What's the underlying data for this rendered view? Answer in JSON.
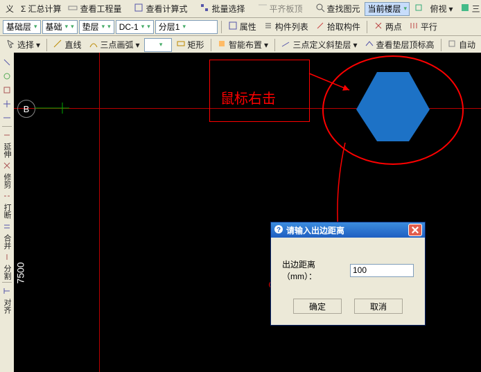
{
  "toolbar1": {
    "yi": "义",
    "sum": "汇总计算",
    "viewqty": "查看工程量",
    "viewcalc": "查看计算式",
    "batch": "批量选择",
    "align": "平齐板顶",
    "find": "查找图元",
    "floor": "当前楼层",
    "view": "俯视",
    "san": "三"
  },
  "toolbar2": {
    "layer1": "基础层",
    "layer2": "基础",
    "layer3": "垫层",
    "dc": "DC-1",
    "split": "分层1",
    "prop": "属性",
    "list": "构件列表",
    "pick": "拾取构件",
    "twop": "两点",
    "para": "平行"
  },
  "toolbar3": {
    "select": "选择",
    "line": "直线",
    "arc": "三点画弧",
    "rect": "矩形",
    "smart": "智能布置",
    "def3": "三点定义斜垫层",
    "viewtop": "查看垫层顶标高",
    "auto": "自动"
  },
  "side": {
    "yan": "延伸",
    "xiu": "修剪",
    "da": "打断",
    "he": "合并",
    "fen": "分割",
    "dui": "对齐"
  },
  "canvas": {
    "marker": "B",
    "dim": "7500"
  },
  "anno": {
    "rightclick": "鼠标右击"
  },
  "dialog": {
    "title": "请输入出边距离",
    "label": "出边距离（mm）：",
    "value": "100",
    "ok": "确定",
    "cancel": "取消"
  }
}
